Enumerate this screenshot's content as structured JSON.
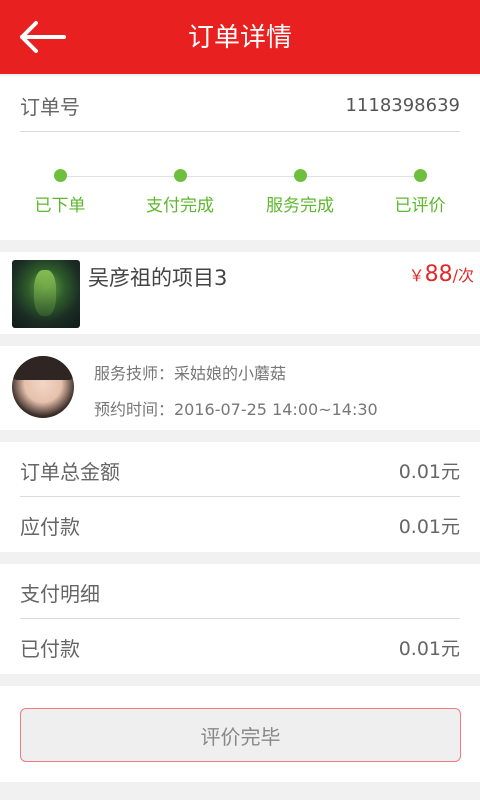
{
  "header": {
    "title": "订单详情",
    "back_icon": "back-arrow-icon"
  },
  "order": {
    "label": "订单号",
    "number": "1118398639",
    "steps": [
      {
        "label": "已下单"
      },
      {
        "label": "支付完成"
      },
      {
        "label": "服务完成"
      },
      {
        "label": "已评价"
      }
    ]
  },
  "product": {
    "name": "吴彦祖的项目3",
    "currency": "￥",
    "price": "88",
    "unit": "/次"
  },
  "technician": {
    "name_line": "服务技师：采姑娘的小蘑菇",
    "time_line": "预约时间：2016-07-25 14:00~14:30"
  },
  "amounts": {
    "total_label": "订单总金额",
    "total_value": "0.01元",
    "payable_label": "应付款",
    "payable_value": "0.01元"
  },
  "payment": {
    "detail_label": "支付明细",
    "paid_label": "已付款",
    "paid_value": "0.01元"
  },
  "action": {
    "button_label": "评价完毕"
  },
  "colors": {
    "primary": "#e82020",
    "step_green": "#5db82d",
    "price_red": "#e02a2a"
  }
}
